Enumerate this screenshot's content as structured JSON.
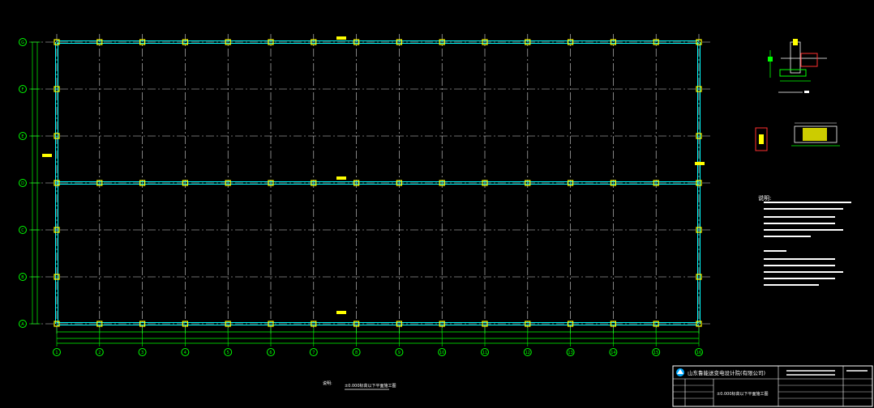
{
  "colors": {
    "background": "#000000",
    "grid_line": "#ffffff",
    "wall": "#00ffff",
    "column": "#ffff00",
    "dimension": "#00ff00",
    "bubble": "#00ff00",
    "title_block_line": "#ffffff",
    "accent_red": "#ff3030",
    "accent_magenta": "#ff40ff"
  },
  "grid": {
    "columns": [
      "1",
      "2",
      "3",
      "4",
      "5",
      "6",
      "7",
      "8",
      "9",
      "10",
      "11",
      "12",
      "13",
      "14",
      "15",
      "16"
    ],
    "rows": [
      "G",
      "F",
      "E",
      "D",
      "C",
      "B",
      "A"
    ]
  },
  "plan": {
    "caption": "±0.000标高以下平面施工图",
    "caption_prefix": "说明:"
  },
  "notes": {
    "heading": "说明:"
  },
  "title_block": {
    "company": "山东鲁能送变电设计院(有限公司)",
    "drawing_title": "±0.000标高以下平面施工图",
    "icons": [
      "company-logo"
    ]
  }
}
